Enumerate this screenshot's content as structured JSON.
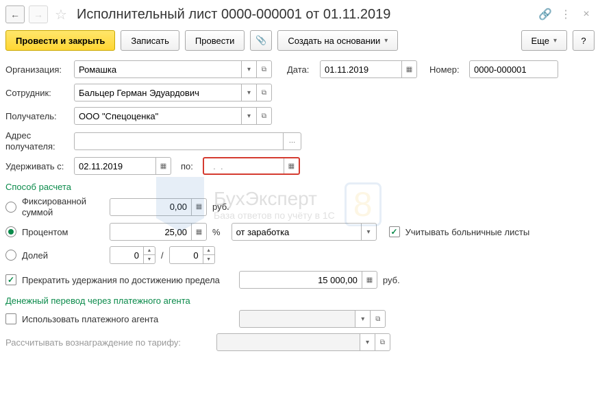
{
  "header": {
    "title": "Исполнительный лист 0000-000001 от 01.11.2019"
  },
  "toolbar": {
    "post_close": "Провести и закрыть",
    "save": "Записать",
    "post": "Провести",
    "create_based": "Создать на основании",
    "more": "Еще",
    "help": "?"
  },
  "labels": {
    "organization": "Организация:",
    "date": "Дата:",
    "number": "Номер:",
    "employee": "Сотрудник:",
    "recipient": "Получатель:",
    "recipient_address": "Адрес получателя:",
    "withhold_from": "Удерживать с:",
    "to": "по:",
    "calc_method": "Способ расчета",
    "fixed_sum": "Фиксированной суммой",
    "percent": "Процентом",
    "fraction": "Долей",
    "rubles": "руб.",
    "pct_sign": "%",
    "slash": "/",
    "consider_sick": "Учитывать больничные листы",
    "stop_on_limit": "Прекратить удержания по достижению предела",
    "transfer_section": "Денежный перевод через платежного агента",
    "use_agent": "Использовать платежного агента",
    "agent_tariff": "Рассчитывать вознаграждение по тарифу:"
  },
  "values": {
    "organization": "Ромашка",
    "date": "01.11.2019",
    "number": "0000-000001",
    "employee": "Бальцер Герман Эдуардович",
    "recipient": "ООО \"Спецоценка\"",
    "recipient_address": "",
    "date_from": "02.11.2019",
    "date_to": "  .  .    ",
    "fixed_amount": "0,00",
    "percent_value": "25,00",
    "percent_base": "от заработка",
    "fraction_num": "0",
    "fraction_den": "0",
    "limit_amount": "15 000,00",
    "agent": "",
    "tariff": ""
  },
  "state": {
    "calc_method": "percent",
    "consider_sick": true,
    "stop_on_limit": true,
    "use_agent": false
  },
  "icons": {
    "dropdown": "▾",
    "open": "⧉",
    "calendar": "▦",
    "calc": "▦",
    "ellipsis": "…",
    "clip": "📎",
    "link": "🔗"
  }
}
